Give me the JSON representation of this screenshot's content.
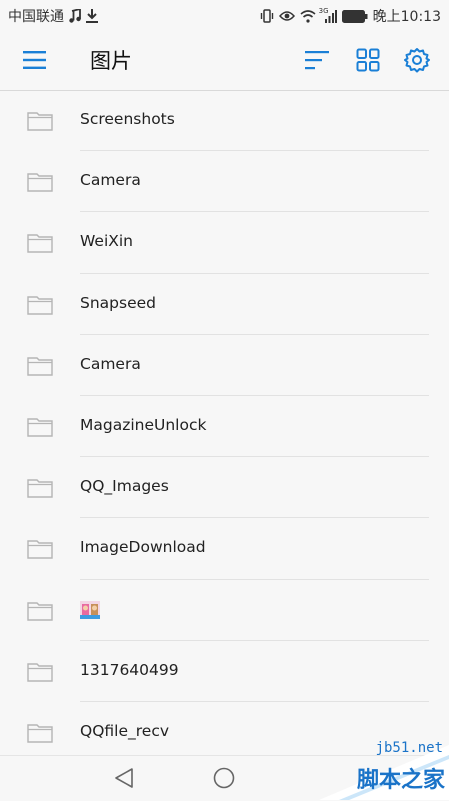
{
  "status_bar": {
    "carrier": "中国联通",
    "network": "3G",
    "time": "晚上10:13",
    "icons": [
      "music-note-icon",
      "download-icon",
      "vibrate-icon",
      "eye-icon",
      "wifi-icon",
      "signal-icon",
      "battery-icon"
    ]
  },
  "app_bar": {
    "title": "图片",
    "accent_color": "#1a7fd6",
    "icons": [
      "menu-icon",
      "sort-icon",
      "grid-view-icon",
      "settings-icon"
    ]
  },
  "folders": [
    {
      "label": "Screenshots"
    },
    {
      "label": "Camera"
    },
    {
      "label": "WeiXin"
    },
    {
      "label": "Snapseed"
    },
    {
      "label": "Camera"
    },
    {
      "label": "MagazineUnlock"
    },
    {
      "label": "QQ_Images"
    },
    {
      "label": "ImageDownload"
    },
    {
      "label": "",
      "emoji_thumbnail": true
    },
    {
      "label": "1317640499"
    },
    {
      "label": "QQfile_recv"
    }
  ],
  "nav_bar": {
    "icons": [
      "back-icon",
      "home-icon"
    ]
  },
  "watermark": {
    "url": "jb51.net",
    "text": "脚本之家"
  }
}
